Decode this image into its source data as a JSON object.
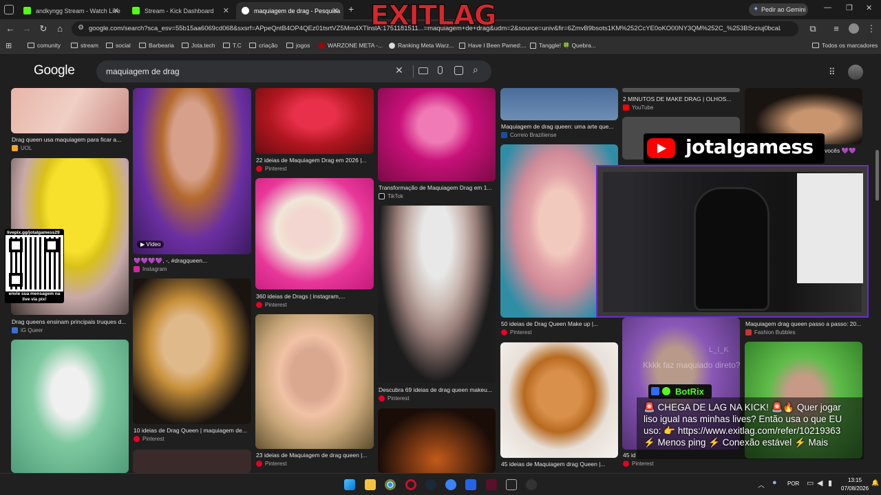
{
  "browser": {
    "tabs": [
      {
        "label": "andkyngg Stream - Watch Live",
        "favicon": "kick-icon"
      },
      {
        "label": "Stream - Kick Dashboard",
        "favicon": "kick-icon"
      },
      {
        "label": "maquiagem de drag - Pesquisa",
        "favicon": "google-icon"
      }
    ],
    "gemini_label": "Pedir ao Gemini",
    "url": "google.com/search?sca_esv=55b15aa6069cd068&sxsrf=APpeQntB4OP4QEz01tsrtVZ5Mm4XTlnslA:1751181511...=maquiagem+de+drag&udm=2&source=univ&fir=6ZmvB9bsots1KM%252CcYE0oKO00NY3QM%252C_%253BSrziuj0bcaLlv...",
    "bookmarks": [
      "comunity",
      "stream",
      "social",
      "Barbearia",
      "Jota.tech",
      "T.C",
      "criação",
      "jogos",
      "WARZONE META -...",
      "Ranking Meta Warz...",
      "Have I Been Pwned:...",
      "Tanggle! 🍀 Quebra..."
    ],
    "all_bookmarks": "Todos os marcadores"
  },
  "google": {
    "logo": "Google",
    "query": "maquiagem de drag"
  },
  "results": [
    {
      "caption": "Drag queen usa maquiagem para ficar a...",
      "source": "UOL",
      "src_color": "#f5a623"
    },
    {
      "caption": "Drag queens ensinam principais truques d...",
      "source": "iG Queer",
      "src_color": "#3b6fd4"
    },
    {
      "caption": "💜💜💜💜, -, #dragqueen...",
      "source": "Instagram",
      "src_color": "#d6249f",
      "badge": "Vídeo"
    },
    {
      "caption": "10 ideias de Drag Queen | maquiagem de...",
      "source": "Pinterest",
      "src_color": "#e60023"
    },
    {
      "caption": "22 ideias de Maquiagem Drag em 2026 |...",
      "source": "Pinterest",
      "src_color": "#e60023"
    },
    {
      "caption": "360 ideias de Drags | instagram,...",
      "source": "Pinterest",
      "src_color": "#e60023"
    },
    {
      "caption": "23 ideias de Maquiagem de drag queen |...",
      "source": "Pinterest",
      "src_color": "#e60023"
    },
    {
      "caption": "Transformação de Maquiagem Drag em 1...",
      "source": "TikTok",
      "src_color": "#111111"
    },
    {
      "caption": "Descubra 69 ideias de drag queen makeu...",
      "source": "Pinterest",
      "src_color": "#e60023"
    },
    {
      "caption": "Maquiagem de drag queen: uma arte que...",
      "source": "Correio Braziliense",
      "src_color": "#1a4fa0"
    },
    {
      "caption": "50 ideias de Drag Queen Make up |...",
      "source": "Pinterest",
      "src_color": "#e60023"
    },
    {
      "caption": "45 ideias de Maquiagem drag Queen |...",
      "source": "Pinterest",
      "src_color": "#e60023"
    },
    {
      "caption": "2 MINUTOS DE MAKE DRAG | OLHOS...",
      "source": "YouTube",
      "src_color": "#ff0000"
    },
    {
      "caption": "Maquiagem drag queen passo a passo: 20...",
      "source": "Fashion Bubbles",
      "src_color": "#c33"
    },
    {
      "caption": "vocês 💜💜",
      "source": "",
      "src_color": "#e60023"
    },
    {
      "caption": "45 id",
      "source": "Pinterest",
      "src_color": "#e60023"
    }
  ],
  "overlay": {
    "brand_logo": "EXITLAG",
    "qr_link": "livepix.gg/jotalgamess29",
    "qr_caption": "envie sua mensagem na live via pix!",
    "channel": "jotalgamess",
    "chat_ghost": "Kkkk faz maquiado direto?",
    "chat_ghost_user": "L_I_K",
    "bot_name": "BotRix",
    "bot_message": "🚨 CHEGA DE LAG NA KICK! 🚨🔥 Quer jogar liso igual nas minhas lives? Então usa o que EU uso: 👉 https://www.exitlag.com/refer/10219363 ⚡ Menos ping ⚡ Conexão estável ⚡ Mais"
  },
  "taskbar": {
    "lang": "POR",
    "time": "13:15",
    "date": "07/08/2026"
  },
  "colors": {
    "accent": "#8ab4f8",
    "kick": "#53fc18",
    "exitlag": "#d7262c",
    "botrix": "#53fc18"
  }
}
